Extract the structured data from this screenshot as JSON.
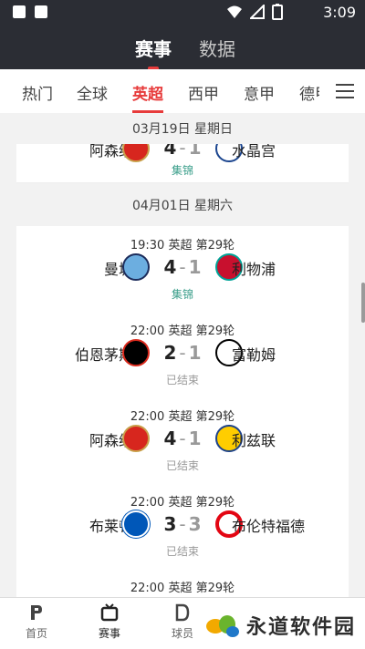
{
  "status": {
    "time": "3:09"
  },
  "header": {
    "tabs": [
      "赛事",
      "数据"
    ]
  },
  "league_tabs": [
    "热门",
    "全球",
    "英超",
    "西甲",
    "意甲",
    "德甲"
  ],
  "sections": [
    {
      "date": "03月19日 星期日"
    },
    {
      "date": "04月01日 星期六"
    }
  ],
  "matches": [
    {
      "time": "",
      "league": "",
      "round": "",
      "home": "阿森纳",
      "away": "水晶宫",
      "score_home": "4",
      "score_away": "1",
      "status": "集锦"
    },
    {
      "time": "19:30",
      "league": "英超",
      "round": "第29轮",
      "home": "曼城",
      "away": "利物浦",
      "score_home": "4",
      "score_away": "1",
      "status": "集锦"
    },
    {
      "time": "22:00",
      "league": "英超",
      "round": "第29轮",
      "home": "伯恩茅斯",
      "away": "富勒姆",
      "score_home": "2",
      "score_away": "1",
      "status": "已结束"
    },
    {
      "time": "22:00",
      "league": "英超",
      "round": "第29轮",
      "home": "阿森纳",
      "away": "利兹联",
      "score_home": "4",
      "score_away": "1",
      "status": "已结束"
    },
    {
      "time": "22:00",
      "league": "英超",
      "round": "第29轮",
      "home": "布莱顿",
      "away": "布伦特福德",
      "score_home": "3",
      "score_away": "3",
      "status": "已结束"
    },
    {
      "time": "22:00",
      "league": "英超",
      "round": "第29轮"
    }
  ],
  "bottom_nav": [
    "首页",
    "赛事",
    "球员"
  ],
  "watermark": "永道软件园",
  "colors": {
    "accent": "#e73b3b",
    "header_bg": "#2b2d34",
    "highlight": "#3a9e8a"
  }
}
